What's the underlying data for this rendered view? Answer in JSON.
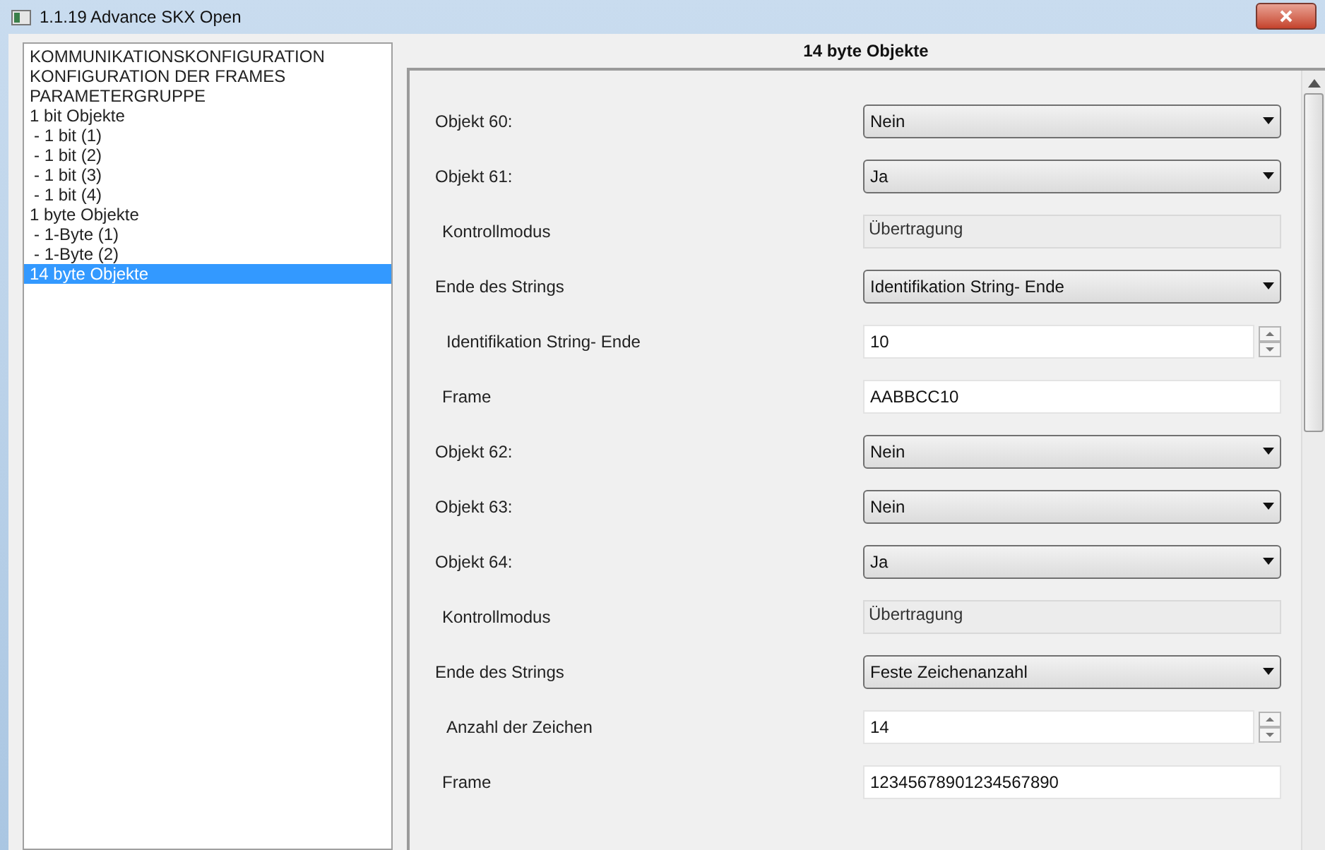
{
  "window": {
    "title": "1.1.19 Advance SKX Open"
  },
  "tree": [
    {
      "label": "KOMMUNIKATIONSKONFIGURATION",
      "selected": false
    },
    {
      "label": "KONFIGURATION DER FRAMES",
      "selected": false
    },
    {
      "label": "PARAMETERGRUPPE",
      "selected": false,
      "children": [
        {
          "label": "1 bit Objekte",
          "selected": false,
          "children": [
            {
              "label": "- 1 bit (1)",
              "selected": false
            },
            {
              "label": "- 1 bit (2)",
              "selected": false
            },
            {
              "label": "- 1 bit (3)",
              "selected": false
            },
            {
              "label": "- 1 bit (4)",
              "selected": false
            }
          ]
        },
        {
          "label": "1 byte Objekte",
          "selected": false,
          "children": [
            {
              "label": "- 1-Byte (1)",
              "selected": false
            },
            {
              "label": "- 1-Byte (2)",
              "selected": false
            }
          ]
        },
        {
          "label": "14 byte Objekte",
          "selected": true
        }
      ]
    }
  ],
  "panel": {
    "title": "14 byte Objekte",
    "rows": [
      {
        "kind": "select",
        "label": "Objekt 60:",
        "value": "Nein"
      },
      {
        "kind": "select",
        "label": "Objekt 61:",
        "value": "Ja"
      },
      {
        "kind": "readonly",
        "label": "Kontrollmodus",
        "value": "Übertragung"
      },
      {
        "kind": "select",
        "label": "Ende des Strings",
        "value": "Identifikation String- Ende"
      },
      {
        "kind": "spin",
        "label": "Identifikation String- Ende",
        "value": "10"
      },
      {
        "kind": "text",
        "label": "Frame",
        "value": "AABBCC10"
      },
      {
        "kind": "select",
        "label": "Objekt 62:",
        "value": "Nein"
      },
      {
        "kind": "select",
        "label": "Objekt 63:",
        "value": "Nein"
      },
      {
        "kind": "select",
        "label": "Objekt 64:",
        "value": "Ja"
      },
      {
        "kind": "readonly",
        "label": "Kontrollmodus",
        "value": "Übertragung"
      },
      {
        "kind": "select",
        "label": "Ende des Strings",
        "value": "Feste Zeichenanzahl"
      },
      {
        "kind": "spin",
        "label": "Anzahl der Zeichen",
        "value": "14"
      },
      {
        "kind": "text",
        "label": "Frame",
        "value": "12345678901234567890"
      }
    ]
  }
}
